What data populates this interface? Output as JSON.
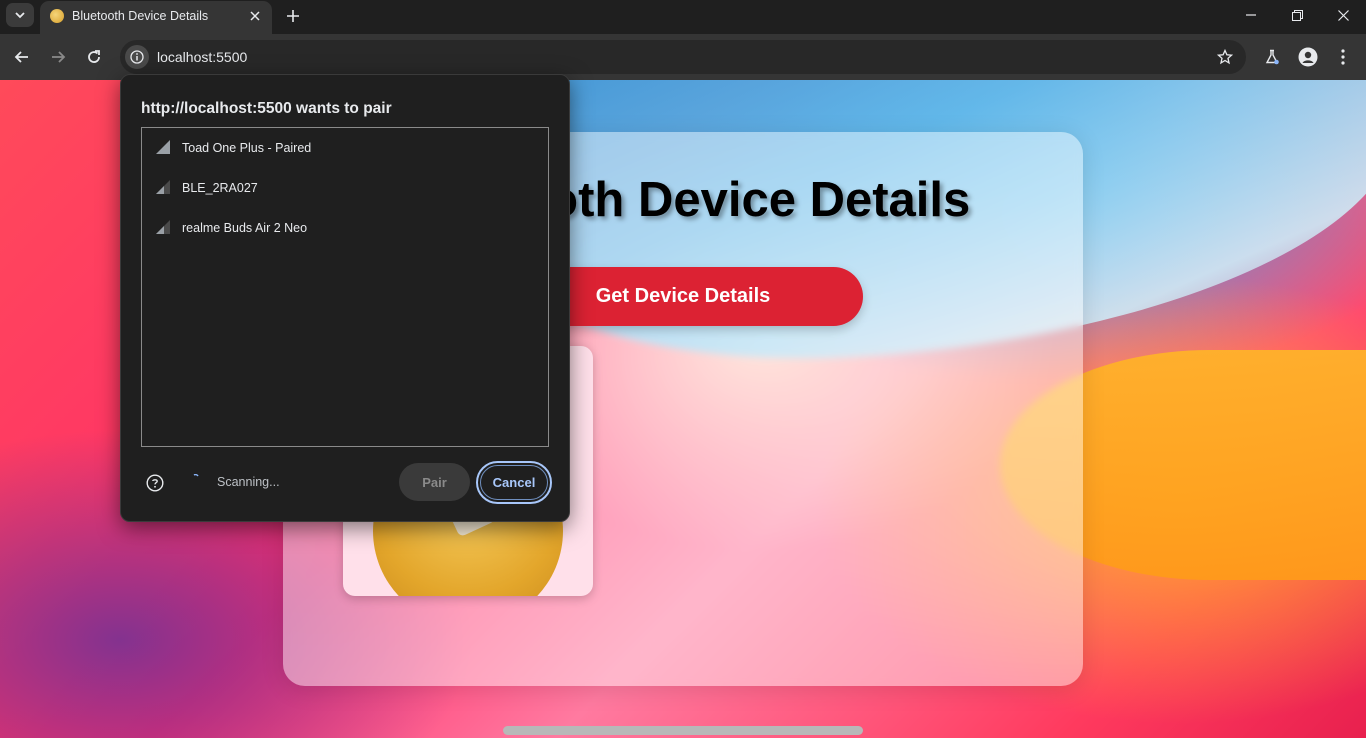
{
  "browser": {
    "tab_title": "Bluetooth Device Details",
    "url": "localhost:5500"
  },
  "page": {
    "title": "Bluetooth Device Details",
    "button_label": "Get Device Details"
  },
  "dialog": {
    "title": "http://localhost:5500 wants to pair",
    "devices": [
      {
        "name": "Toad One Plus - Paired",
        "signal_icon": "signal-strong-icon"
      },
      {
        "name": "BLE_2RA027",
        "signal_icon": "signal-weak-icon"
      },
      {
        "name": "realme Buds Air 2 Neo",
        "signal_icon": "signal-weak-icon"
      }
    ],
    "status": "Scanning...",
    "pair_label": "Pair",
    "cancel_label": "Cancel"
  },
  "colors": {
    "accent_button": "#dc2233",
    "focus_ring": "#a8c7fa",
    "dialog_bg": "#1f1f1f"
  }
}
